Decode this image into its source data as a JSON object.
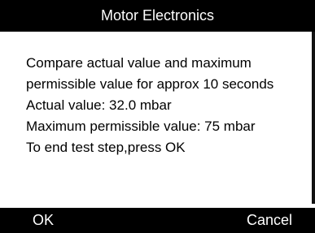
{
  "header": {
    "title": "Motor Electronics"
  },
  "message": {
    "lines": [
      "Compare actual value and maximum",
      "permissible value for approx 10 seconds",
      "Actual value: 32.0 mbar",
      "Maximum permissible value: 75 mbar",
      "To end test step,press OK"
    ]
  },
  "footer": {
    "ok_label": "OK",
    "cancel_label": "Cancel"
  }
}
